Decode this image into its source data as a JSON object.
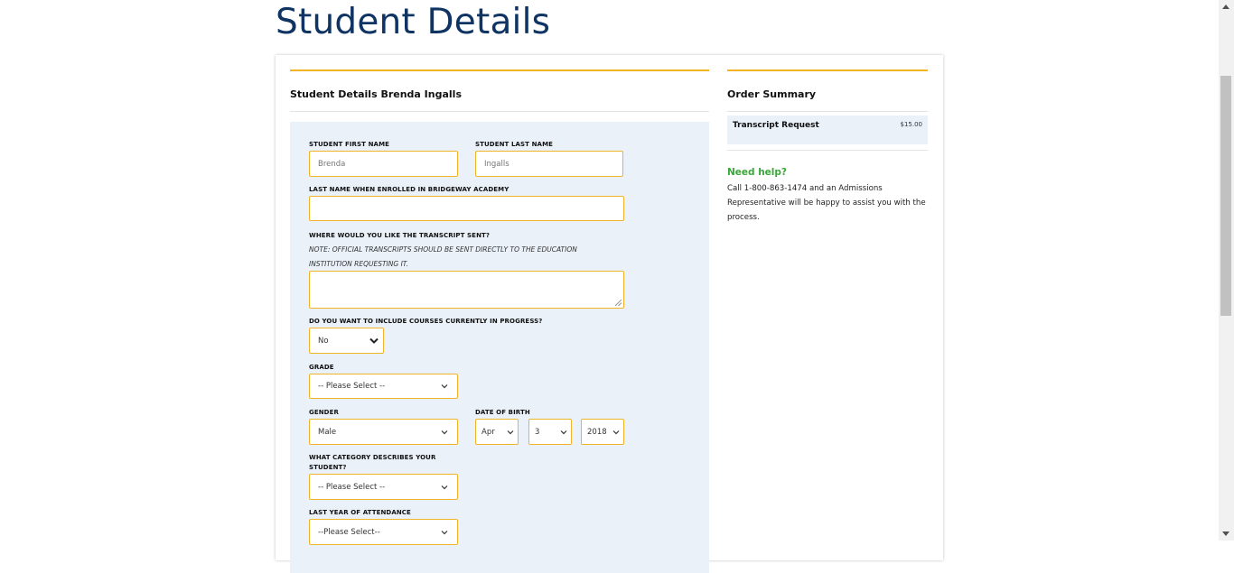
{
  "page": {
    "title": "Student Details"
  },
  "details": {
    "title": "Student Details Brenda Ingalls"
  },
  "form": {
    "first_name": {
      "label": "STUDENT FIRST NAME",
      "placeholder": "Brenda"
    },
    "last_name": {
      "label": "STUDENT LAST NAME",
      "placeholder": "Ingalls"
    },
    "enrolled_last_name": {
      "label": "LAST NAME WHEN ENROLLED IN BRIDGEWAY ACADEMY",
      "value": ""
    },
    "transcript_destination": {
      "label": "WHERE WOULD YOU LIKE THE TRANSCRIPT SENT?",
      "note": "NOTE: OFFICIAL TRANSCRIPTS SHOULD BE SENT DIRECTLY TO THE EDUCATION INSTITUTION REQUESTING IT.",
      "value": ""
    },
    "include_in_progress": {
      "label": "DO YOU WANT TO INCLUDE COURSES CURRENTLY IN PROGRESS?",
      "value": "No"
    },
    "grade": {
      "label": "GRADE",
      "value": "-- Please Select --"
    },
    "gender": {
      "label": "GENDER",
      "value": "Male"
    },
    "date_of_birth": {
      "label": "DATE OF BIRTH",
      "month": "Apr",
      "day": "3",
      "year": "2018"
    },
    "category": {
      "label": "WHAT CATEGORY DESCRIBES YOUR STUDENT?",
      "value": "-- Please Select --"
    },
    "last_year_attendance": {
      "label": "LAST YEAR OF ATTENDANCE",
      "value": "--Please Select--"
    }
  },
  "summary": {
    "title": "Order Summary",
    "item_name": "Transcript Request",
    "item_price": "$15.00"
  },
  "help": {
    "title": "Need help?",
    "text": "Call 1-800-863-1474 and an Admissions Representative will be happy to assist you with the process."
  },
  "colors": {
    "title": "#0f3464",
    "accent_gold": "#f3b324",
    "panel_bg": "#eaf1f9",
    "help_green": "#3aa63a"
  }
}
